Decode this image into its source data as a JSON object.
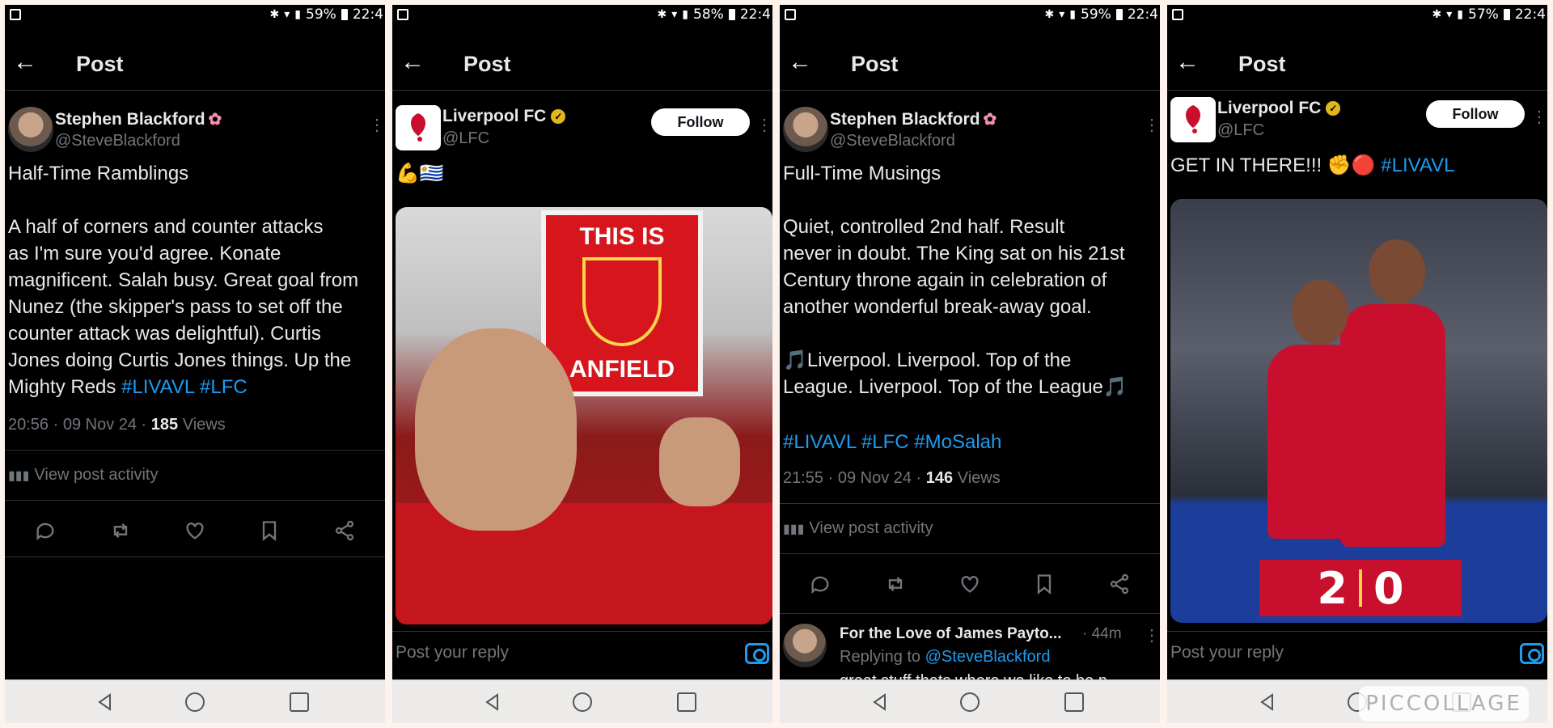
{
  "panels": [
    {
      "status": {
        "battery": "59%",
        "time": "22:4"
      },
      "header": {
        "title": "Post"
      },
      "author": {
        "name": "Stephen Blackford",
        "handle": "@SteveBlackford"
      },
      "post": {
        "title": "Half-Time Ramblings",
        "text": "A half of corners and counter attacks\nas I'm sure you'd agree. Konate\nmagnificent. Salah busy. Great goal from\nNunez (the skipper's pass to set off the\ncounter attack was delightful). Curtis\nJones doing Curtis Jones things. Up the\nMighty Reds ",
        "hashtags": "#LIVAVL #LFC",
        "timestamp": "20:56 · 09 Nov 24 · ",
        "views_count": "185",
        "views_label": " Views"
      },
      "activity_label": "View post activity"
    },
    {
      "status": {
        "battery": "58%",
        "time": "22:4"
      },
      "header": {
        "title": "Post"
      },
      "author": {
        "name": "Liverpool FC",
        "handle": "@LFC"
      },
      "follow_label": "Follow",
      "post": {
        "text": "💪🇺🇾"
      },
      "image": {
        "sign_top": "THIS IS",
        "sign_bottom": "ANFIELD"
      },
      "reply_placeholder": "Post your reply"
    },
    {
      "status": {
        "battery": "59%",
        "time": "22:4"
      },
      "header": {
        "title": "Post"
      },
      "author": {
        "name": "Stephen Blackford",
        "handle": "@SteveBlackford"
      },
      "post": {
        "title": "Full-Time Musings",
        "text": "Quiet, controlled 2nd half. Result\nnever in doubt. The King sat on his 21st\nCentury throne again in celebration of\nanother wonderful break-away goal.\n\n🎵Liverpool. Liverpool. Top of the\nLeague. Liverpool. Top of the League🎵",
        "hashtags": "#LIVAVL #LFC #MoSalah",
        "timestamp": "21:55 · 09 Nov 24 · ",
        "views_count": "146",
        "views_label": " Views"
      },
      "activity_label": "View post activity",
      "reply": {
        "name": "For the Love of James Payto...",
        "time": "· 44m",
        "replying_prefix": "Replying to ",
        "replying_handle": "@SteveBlackford",
        "snippet": "great stuff thats where we like to be n..."
      }
    },
    {
      "status": {
        "battery": "57%",
        "time": "22:4"
      },
      "header": {
        "title": "Post"
      },
      "author": {
        "name": "Liverpool FC",
        "handle": "@LFC"
      },
      "follow_label": "Follow",
      "post": {
        "text": "GET IN THERE!!! ✊🔴 ",
        "hashtags": "#LIVAVL"
      },
      "image": {
        "score_home": "2",
        "score_away": "0"
      },
      "reply_placeholder": "Post your reply"
    }
  ],
  "watermark": "PICCOLLAGE",
  "colors": {
    "accent": "#1d9bf0",
    "background": "#000000",
    "muted": "#71767b",
    "lfc_red": "#c8102e"
  }
}
